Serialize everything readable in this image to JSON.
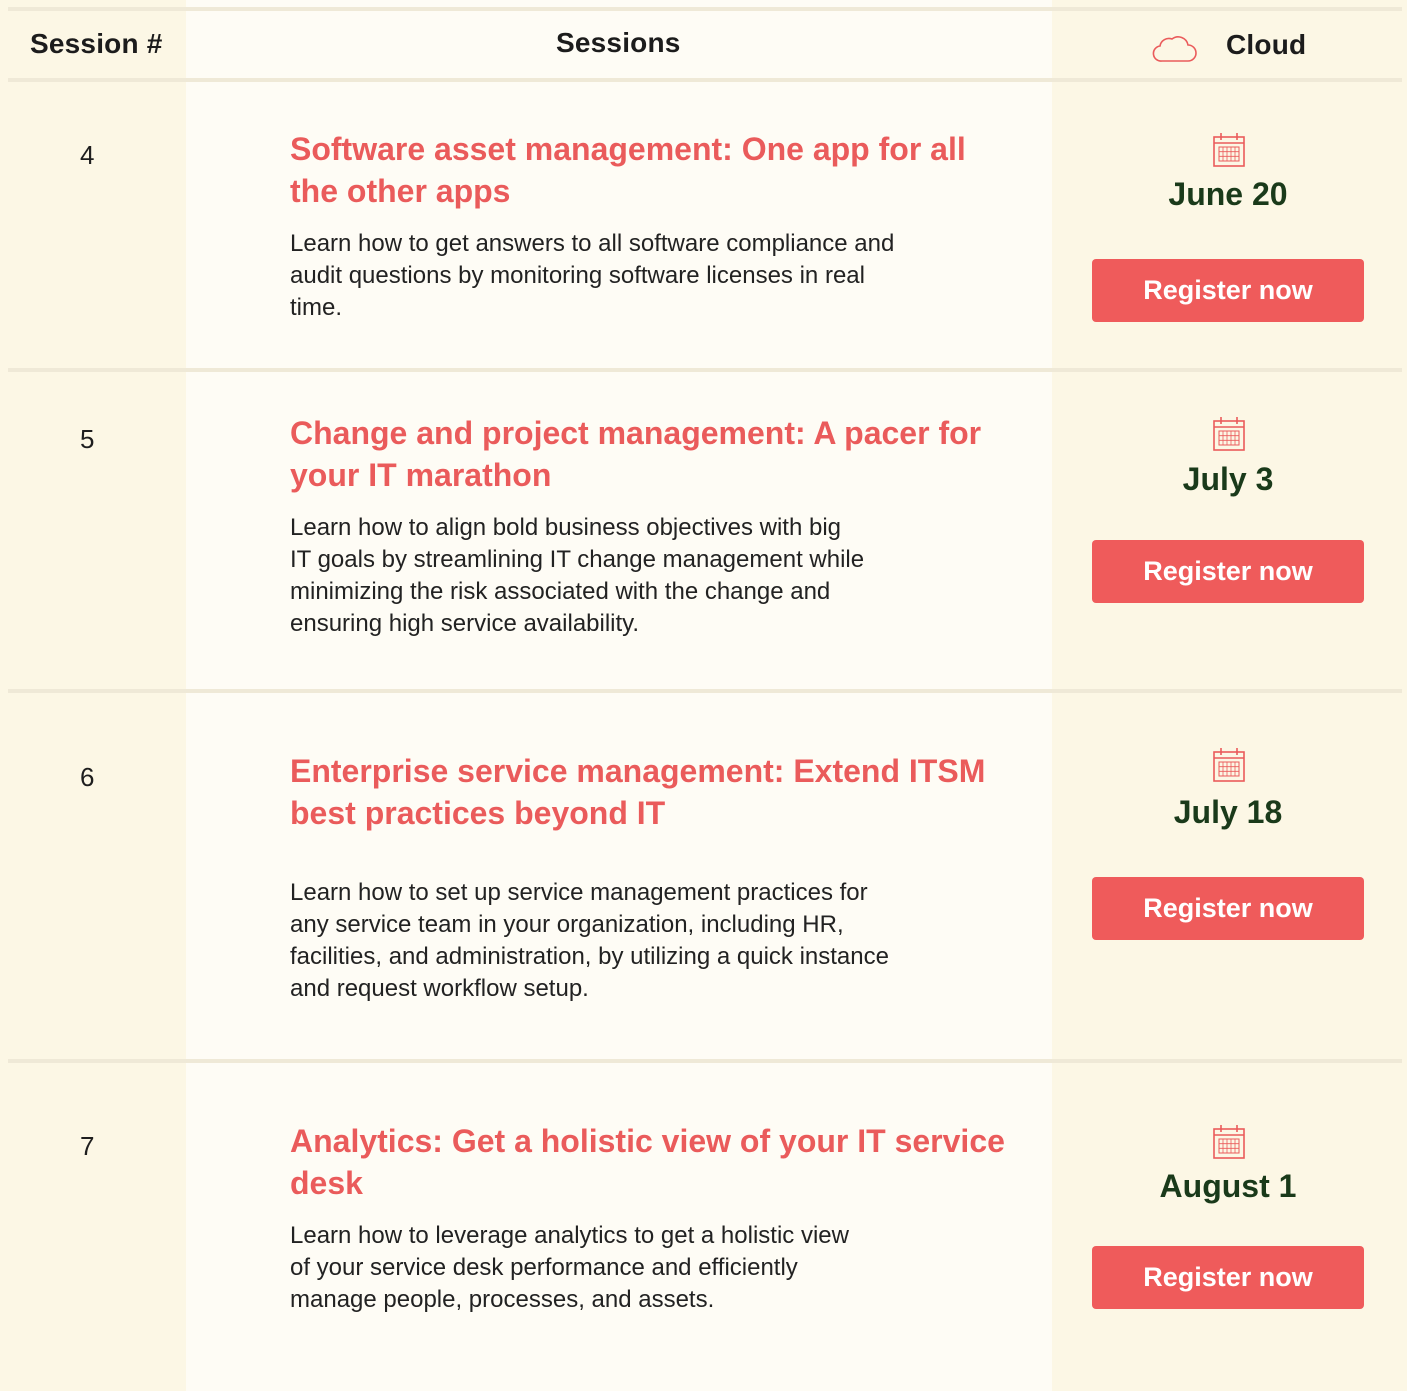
{
  "header": {
    "session_num_label": "Session #",
    "sessions_label": "Sessions",
    "cloud_label": "Cloud"
  },
  "rows": [
    {
      "num": "4",
      "title": "Software asset management: One app for all the other apps",
      "desc_lines": [
        "Learn how to get answers to all software compliance and",
        "audit questions by monitoring software licenses in real",
        "time."
      ],
      "date": "June 20",
      "button": "Register now"
    },
    {
      "num": "5",
      "title": "Change and project management: A pacer for your IT marathon",
      "desc_lines": [
        "Learn how to align bold business objectives with big",
        "IT goals by streamlining IT change management while",
        "minimizing the risk associated with the change and",
        "ensuring high service availability."
      ],
      "date": "July 3",
      "button": "Register now"
    },
    {
      "num": "6",
      "title": "Enterprise service management: Extend ITSM best practices beyond IT",
      "desc_lines": [
        "Learn how to set up service management practices for",
        "any service team in your organization, including HR,",
        "facilities, and administration, by utilizing a quick instance",
        "and request workflow setup."
      ],
      "date": "July 18",
      "button": "Register now"
    },
    {
      "num": "7",
      "title": "Analytics: Get a holistic view of your IT service desk",
      "desc_lines": [
        "Learn how to leverage analytics to get a holistic view",
        "of your service desk performance and efficiently",
        "manage people, processes, and assets."
      ],
      "date": "August 1",
      "button": "Register now"
    }
  ],
  "icons": {
    "cloud": "cloud-icon",
    "calendar": "calendar-icon"
  },
  "colors": {
    "accent": "#ea5b5b",
    "button": "#ef5b5b",
    "date_text": "#1a3a1a"
  }
}
